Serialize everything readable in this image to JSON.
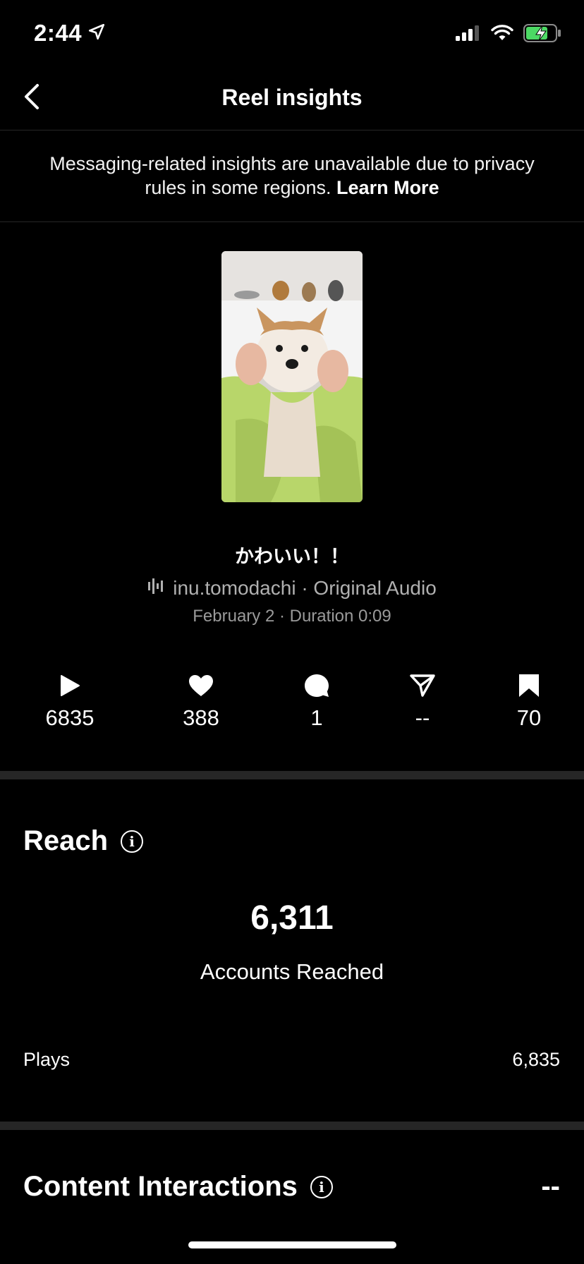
{
  "status_bar": {
    "time": "2:44",
    "icons": [
      "location-arrow-icon",
      "cellular-signal-icon",
      "wifi-icon",
      "battery-charging-icon"
    ]
  },
  "header": {
    "title": "Reel insights",
    "back_icon": "chevron-left-icon"
  },
  "notice": {
    "text": "Messaging-related insights are unavailable due to privacy rules in some regions.",
    "link_label": "Learn More"
  },
  "reel": {
    "caption": "かわいい！！",
    "audio_icon": "audio-waveform-icon",
    "audio": "inu.tomodachi · Original Audio",
    "meta": "February 2 · Duration 0:09"
  },
  "stats": [
    {
      "icon": "play-icon",
      "value": "6835"
    },
    {
      "icon": "heart-icon",
      "value": "388"
    },
    {
      "icon": "comment-icon",
      "value": "1"
    },
    {
      "icon": "share-icon",
      "value": "--"
    },
    {
      "icon": "bookmark-icon",
      "value": "70"
    }
  ],
  "reach": {
    "title": "Reach",
    "accounts_reached_value": "6,311",
    "accounts_reached_label": "Accounts Reached",
    "plays_label": "Plays",
    "plays_value": "6,835"
  },
  "content_interactions": {
    "title": "Content Interactions",
    "value": "--"
  },
  "colors": {
    "background": "#000000",
    "divider": "#262626",
    "secondary_text": "#b0b0b0",
    "battery_green": "#4cd964"
  }
}
